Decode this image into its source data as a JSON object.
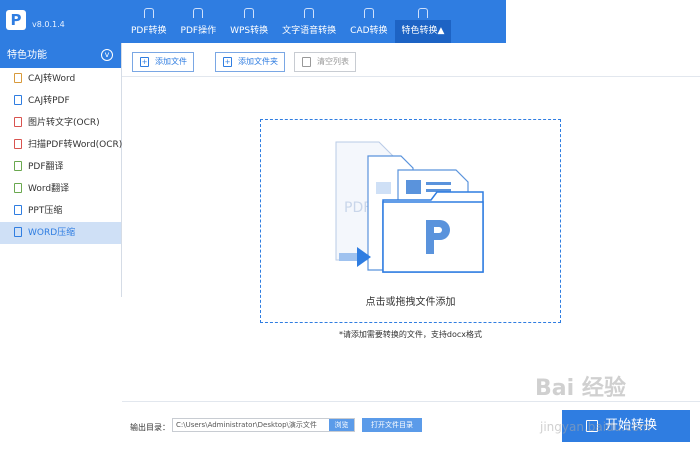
{
  "app": {
    "version": "v8.0.1.4"
  },
  "nav": {
    "items": [
      {
        "label": "PDF转换"
      },
      {
        "label": "PDF操作"
      },
      {
        "label": "WPS转换"
      },
      {
        "label": "文字语音转换"
      },
      {
        "label": "CAD转换"
      },
      {
        "label": "特色转换▲",
        "active": true
      }
    ]
  },
  "sidebar": {
    "header": "特色功能",
    "items": [
      {
        "label": "CAJ转Word"
      },
      {
        "label": "CAJ转PDF"
      },
      {
        "label": "图片转文字(OCR)"
      },
      {
        "label": "扫描PDF转Word(OCR)"
      },
      {
        "label": "PDF翻译"
      },
      {
        "label": "Word翻译"
      },
      {
        "label": "PPT压缩"
      },
      {
        "label": "WORD压缩",
        "active": true
      }
    ]
  },
  "toolbar": {
    "add_file": "添加文件",
    "add_folder": "添加文件夹",
    "clear_list": "清空列表"
  },
  "dropzone": {
    "text": "点击或拖拽文件添加",
    "hint": "*请添加需要转换的文件，支持docx格式",
    "illustration_label": "PDF"
  },
  "output": {
    "label": "输出目录：",
    "path": "C:\\Users\\Administrator\\Desktop\\演示文件",
    "browse": "浏览",
    "open_dir": "打开文件目录"
  },
  "start_button": "开始转换",
  "watermark": {
    "text": "Bai 经验",
    "sub": "jingyan.baidu.com"
  },
  "colors": {
    "accent": "#2f7de1",
    "active_nav": "#1d63c4",
    "sidebar_active": "#cfe0f6"
  }
}
